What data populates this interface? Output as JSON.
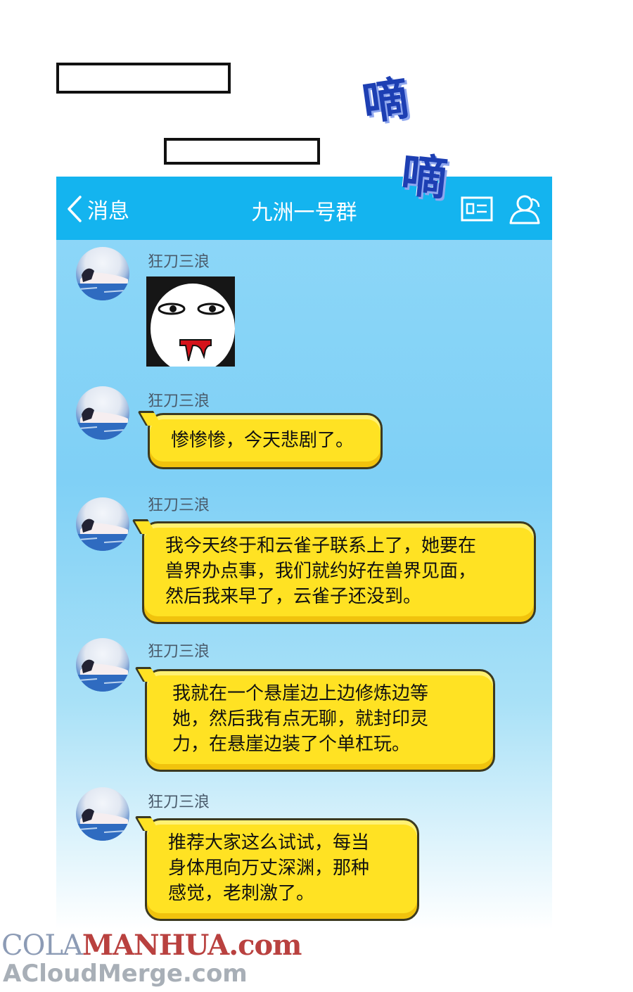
{
  "captions": [
    "",
    ""
  ],
  "sfx": [
    "嘀",
    "嘀"
  ],
  "header": {
    "back_label": "消息",
    "title": "九洲一号群"
  },
  "messages": [
    {
      "sender": "狂刀三浪",
      "type": "sticker"
    },
    {
      "sender": "狂刀三浪",
      "text": "惨惨惨，今天悲剧了。"
    },
    {
      "sender": "狂刀三浪",
      "text": "我今天终于和云雀子联系上了，她要在\n兽界办点事，我们就约好在兽界见面，\n然后我来早了，云雀子还没到。"
    },
    {
      "sender": "狂刀三浪",
      "text": "我就在一个悬崖边上边修炼边等\n她，然后我有点无聊，就封印灵\n力，在悬崖边装了个单杠玩。"
    },
    {
      "sender": "狂刀三浪",
      "text": "推荐大家这么试试，每当\n身体甩向万丈深渊，那种\n感觉，老刺激了。"
    }
  ],
  "watermark": {
    "line1_a": "COLA",
    "line1_b": "MANHUA.com",
    "line2": "ACloudMerge.com"
  },
  "colors": {
    "header": "#14b4ef",
    "chat_bg": "#8fd8f8",
    "bubble": "#ffe223"
  },
  "icons": [
    "chevron-left-icon",
    "contact-card-icon",
    "group-members-icon"
  ]
}
